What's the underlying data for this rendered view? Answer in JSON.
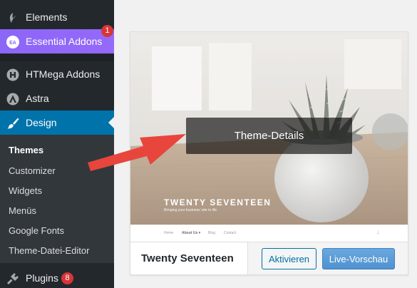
{
  "sidebar": {
    "items": [
      {
        "label": "Elements",
        "icon": "elementor-icon"
      },
      {
        "label": "Essential Addons",
        "icon": "essential-addons-icon",
        "badge": "1"
      },
      {
        "label": "HTMega Addons",
        "icon": "htmega-icon"
      },
      {
        "label": "Astra",
        "icon": "astra-icon"
      },
      {
        "label": "Design",
        "icon": "paintbrush-icon"
      },
      {
        "label": "Plugins",
        "icon": "plugin-icon",
        "badge": "8"
      }
    ],
    "submenu": [
      {
        "label": "Themes"
      },
      {
        "label": "Customizer"
      },
      {
        "label": "Widgets"
      },
      {
        "label": "Menüs"
      },
      {
        "label": "Google Fonts"
      },
      {
        "label": "Theme-Datei-Editor"
      }
    ],
    "essential_icon_text": "EA"
  },
  "theme_card": {
    "overlay_button": "Theme-Details",
    "screenshot": {
      "title": "TWENTY SEVENTEEN",
      "tagline": "Bringing your business’ site to life",
      "nav": [
        "Home",
        "About Us ▾",
        "Blog",
        "Contact"
      ],
      "nav_arrow": "↓"
    },
    "name": "Twenty Seventeen",
    "activate_label": "Aktivieren",
    "preview_label": "Live-Vorschau"
  },
  "colors": {
    "sidebar_bg": "#23282d",
    "active": "#0073aa",
    "essential": "#8c66f7",
    "badge": "#d63638",
    "arrow": "#e8453c"
  }
}
